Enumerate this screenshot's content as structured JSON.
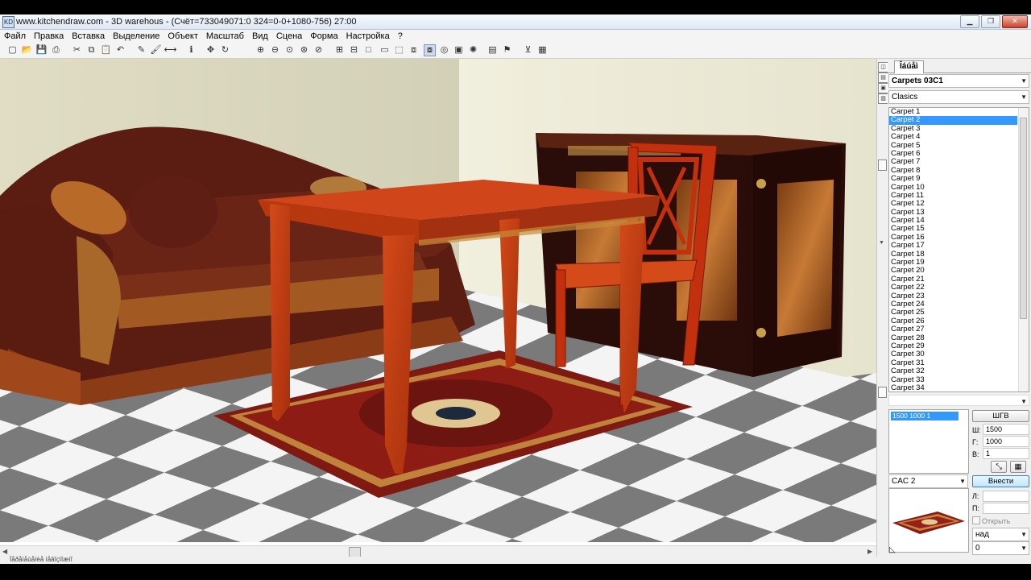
{
  "window": {
    "title": "www.kitchendraw.com - 3D warehous - (Счёт=733049071:0 324=0-0+1080-756) 27:00",
    "app_icon": "KD",
    "buttons": [
      "minimize-icon",
      "restore-icon",
      "close-icon"
    ]
  },
  "menu": [
    "Файл",
    "Правка",
    "Вставка",
    "Выделение",
    "Объект",
    "Масштаб",
    "Вид",
    "Сцена",
    "Форма",
    "Настройка",
    "?"
  ],
  "toolbar": {
    "icons": [
      "new-file-icon",
      "open-folder-icon",
      "save-icon",
      "print-icon",
      "cut-icon",
      "copy-icon",
      "paste-icon",
      "undo-icon",
      "edit-icon",
      "paint-icon",
      "measure-icon",
      "info-icon",
      "move-icon",
      "rotate-icon",
      "zoom-in-icon",
      "zoom-out-icon",
      "zoom-window-icon",
      "zoom-all-icon",
      "zoom-previous-icon",
      "plan-view-icon",
      "elevation-view-icon",
      "frame-icon",
      "color-frame-icon",
      "cube-icon",
      "shaded-view-icon",
      "render-view-icon",
      "camera-icon",
      "photo-icon",
      "light-icon",
      "cabinet-icon",
      "walk-icon",
      "catalog-icon",
      "help-icon"
    ],
    "pressed_index": 25
  },
  "panel": {
    "tab_label": "Îáúåì",
    "catalog_combo": "Carpets 03C1",
    "category_combo": "Clasics",
    "items": [
      "Carpet 1",
      "Carpet 2",
      "Carpet 3",
      "Carpet 4",
      "Carpet 5",
      "Carpet 6",
      "Carpet 7",
      "Carpet 8",
      "Carpet 9",
      "Carpet 10",
      "Carpet 11",
      "Carpet 12",
      "Carpet 13",
      "Carpet 14",
      "Carpet 15",
      "Carpet 16",
      "Carpet 17",
      "Carpet 18",
      "Carpet 19",
      "Carpet 20",
      "Carpet 21",
      "Carpet 22",
      "Carpet 23",
      "Carpet 24",
      "Carpet 25",
      "Carpet 26",
      "Carpet 27",
      "Carpet 28",
      "Carpet 29",
      "Carpet 30",
      "Carpet 31",
      "Carpet 32",
      "Carpet 33",
      "Carpet 34"
    ],
    "selected_item": "Carpet 2",
    "size_row": "1500 1000    1",
    "button_whd": "ШГВ",
    "field_w_label": "Ш:",
    "field_w": "1500",
    "field_d_label": "Г:",
    "field_d": "1000",
    "field_h_label": "В:",
    "field_h": "1",
    "model_combo": "CAC 2",
    "insert_button": "Внести",
    "field_l_label": "Л:",
    "field_p_label": "П:",
    "open_checkbox": "Открыть",
    "position_combo": "над",
    "position_value": "0"
  },
  "status": "Ïåðåìåùåíèå íåâîçìîæíî"
}
